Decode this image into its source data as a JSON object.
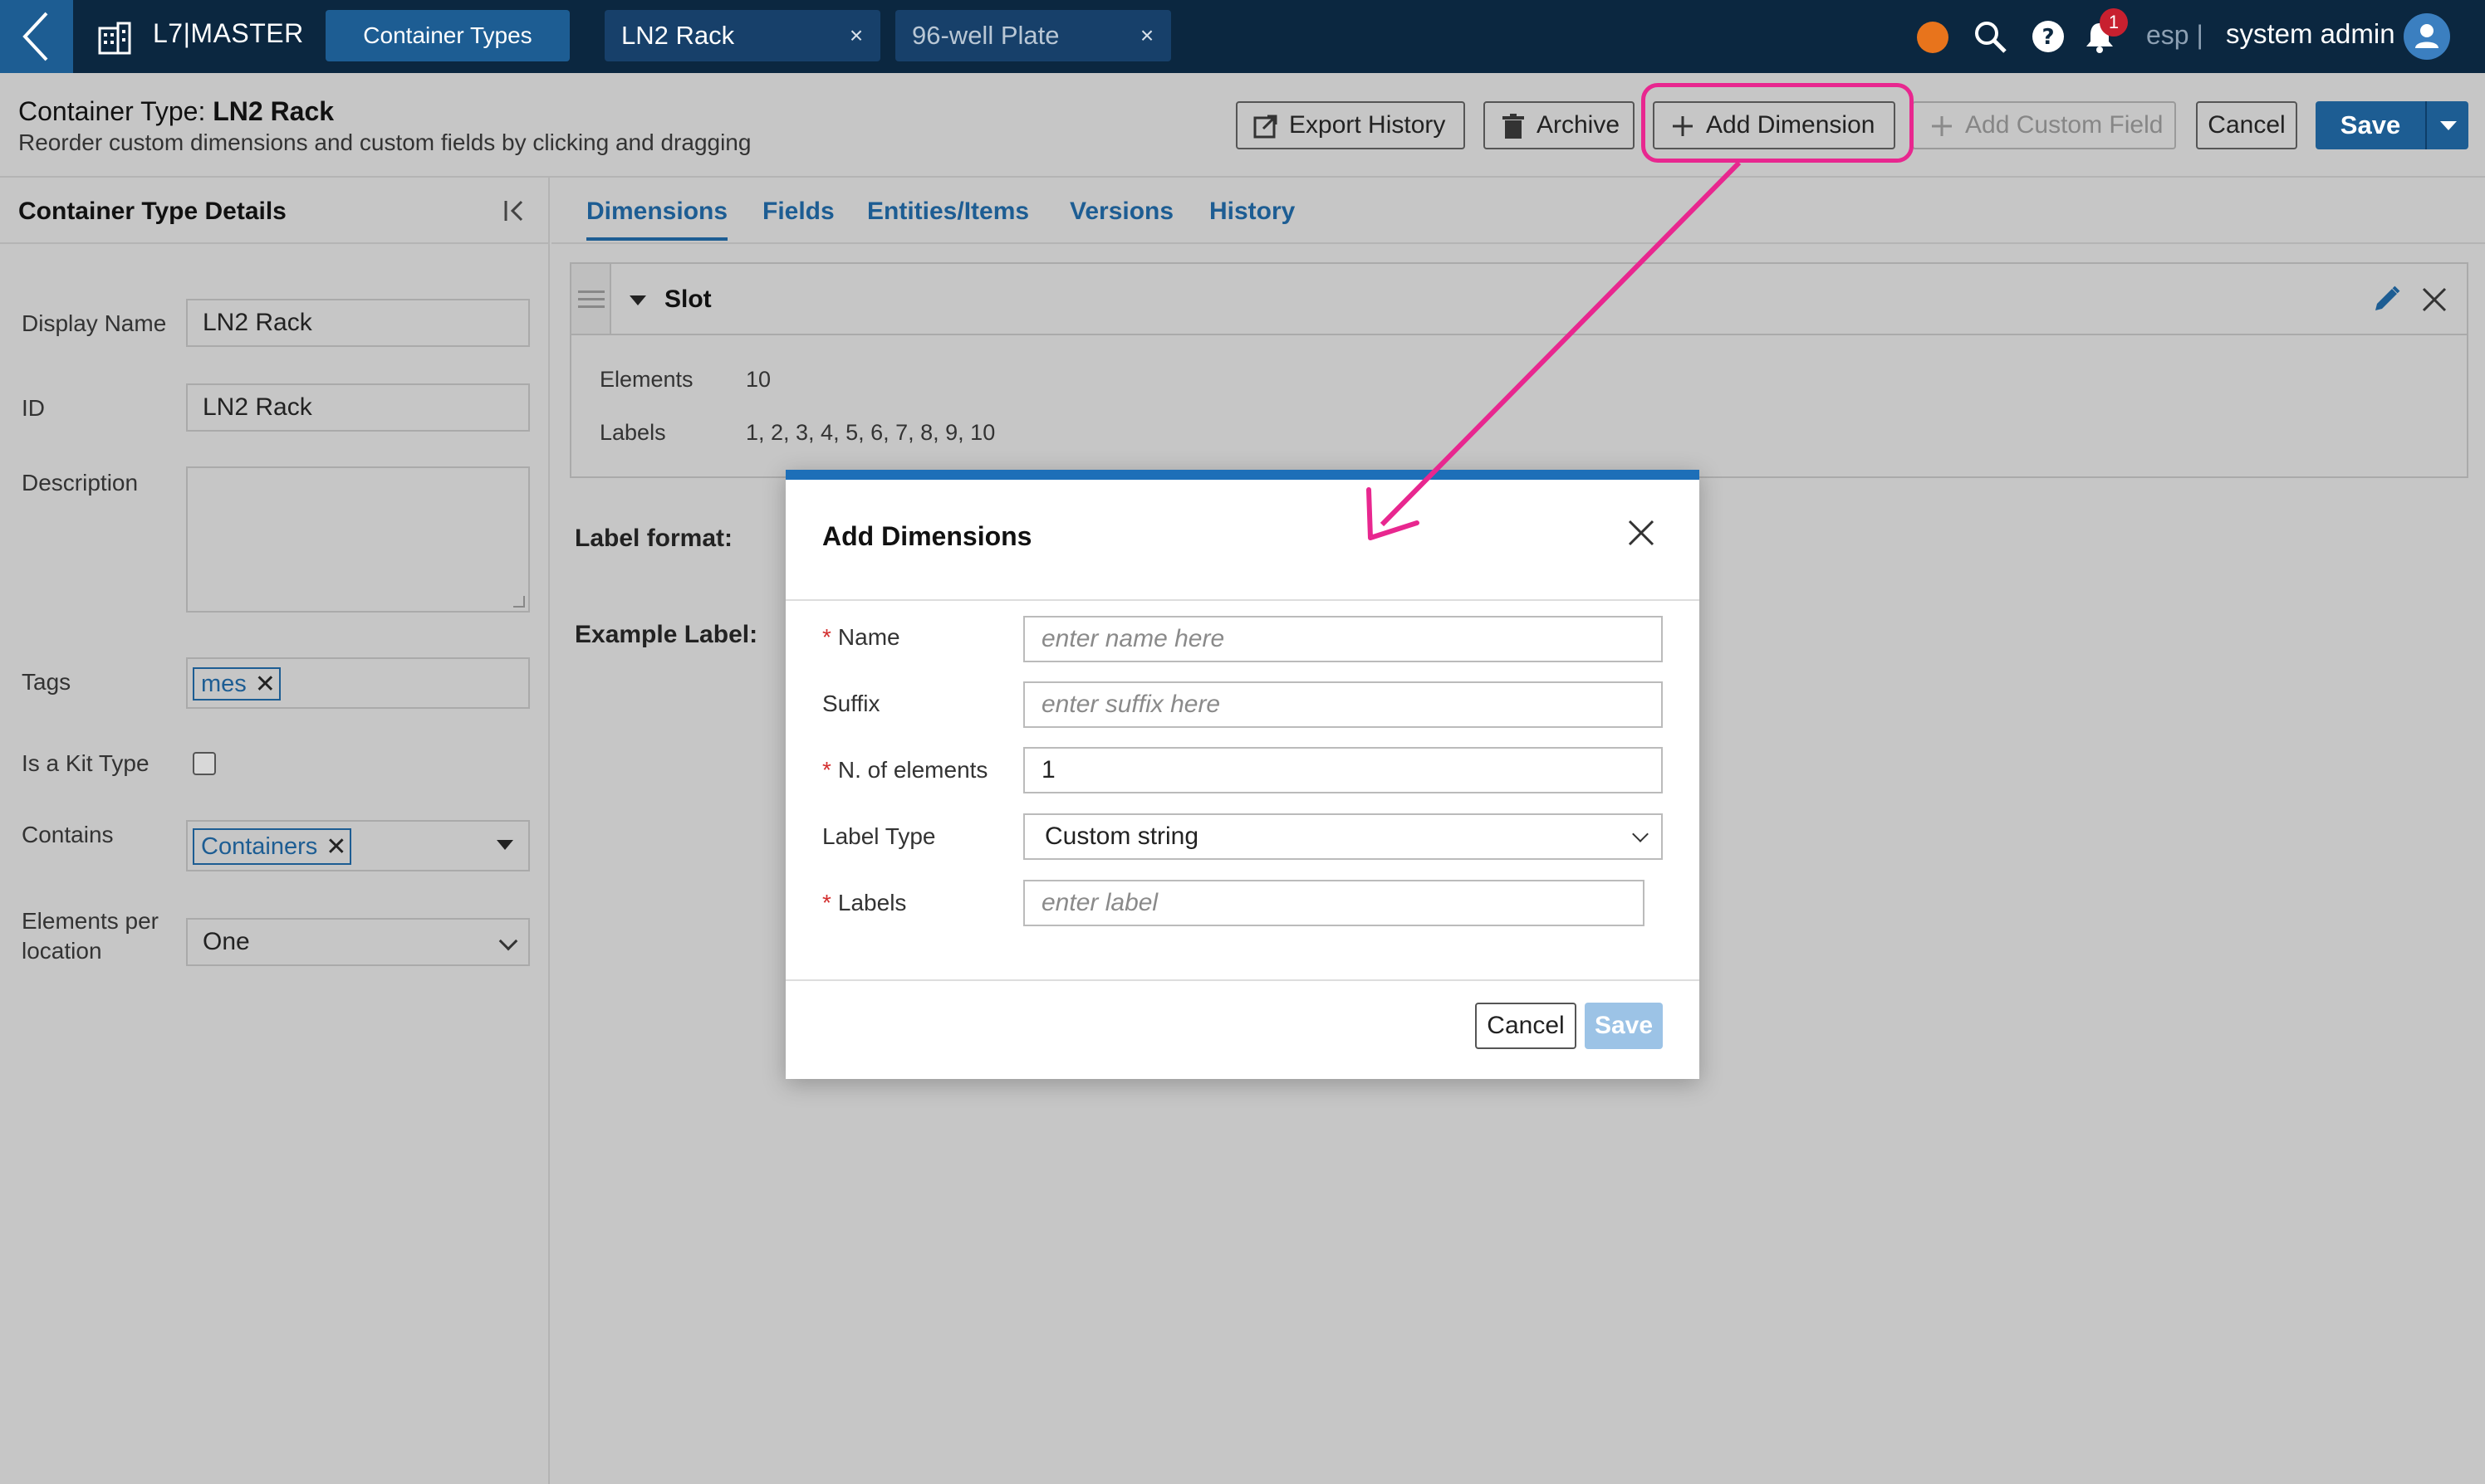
{
  "topbar": {
    "app_name": "L7|MASTER",
    "active_tab": "Container Types",
    "open_tabs": [
      {
        "label": "LN2 Rack",
        "close": "×"
      },
      {
        "label": "96-well Plate",
        "close": "×"
      }
    ],
    "notification_count": "1",
    "language": "esp |",
    "user_name": "system admin",
    "status_color": "#e8741c"
  },
  "header": {
    "title_prefix": "Container Type: ",
    "title_name": "LN2 Rack",
    "subtitle": "Reorder custom dimensions and custom fields by clicking and dragging",
    "buttons": {
      "export_history": "Export History",
      "archive": "Archive",
      "add_dimension": "Add Dimension",
      "add_custom_field": "Add Custom Field",
      "cancel": "Cancel",
      "save": "Save"
    }
  },
  "left_panel": {
    "title": "Container Type Details",
    "fields": {
      "display_name_label": "Display Name",
      "display_name_value": "LN2 Rack",
      "id_label": "ID",
      "id_value": "LN2 Rack",
      "description_label": "Description",
      "tags_label": "Tags",
      "tag_values": [
        "mes"
      ],
      "kit_type_label": "Is a Kit Type",
      "contains_label": "Contains",
      "contains_values": [
        "Containers"
      ],
      "elements_per_location_label_1": "Elements per",
      "elements_per_location_label_2": "location",
      "elements_per_location_value": "One"
    }
  },
  "main": {
    "tabs": [
      "Dimensions",
      "Fields",
      "Entities/Items",
      "Versions",
      "History"
    ],
    "active_tab": "Dimensions",
    "dimension": {
      "name": "Slot",
      "elements_label": "Elements",
      "elements_value": "10",
      "labels_label": "Labels",
      "labels_value": "1, 2, 3, 4, 5, 6, 7, 8, 9, 10"
    },
    "label_format_label": "Label format:",
    "example_label_label": "Example Label:"
  },
  "modal": {
    "title": "Add Dimensions",
    "fields": {
      "name_label": "Name",
      "name_placeholder": "enter name here",
      "suffix_label": "Suffix",
      "suffix_placeholder": "enter suffix here",
      "n_elements_label": "N. of elements",
      "n_elements_value": "1",
      "label_type_label": "Label Type",
      "label_type_value": "Custom string",
      "labels_label": "Labels",
      "labels_placeholder": "enter label"
    },
    "required_mark": "*",
    "cancel": "Cancel",
    "save": "Save"
  },
  "colors": {
    "nav_bg": "#0b2740",
    "primary": "#1d5d93",
    "annotation": "#e8278f",
    "required": "#d32f2f"
  }
}
